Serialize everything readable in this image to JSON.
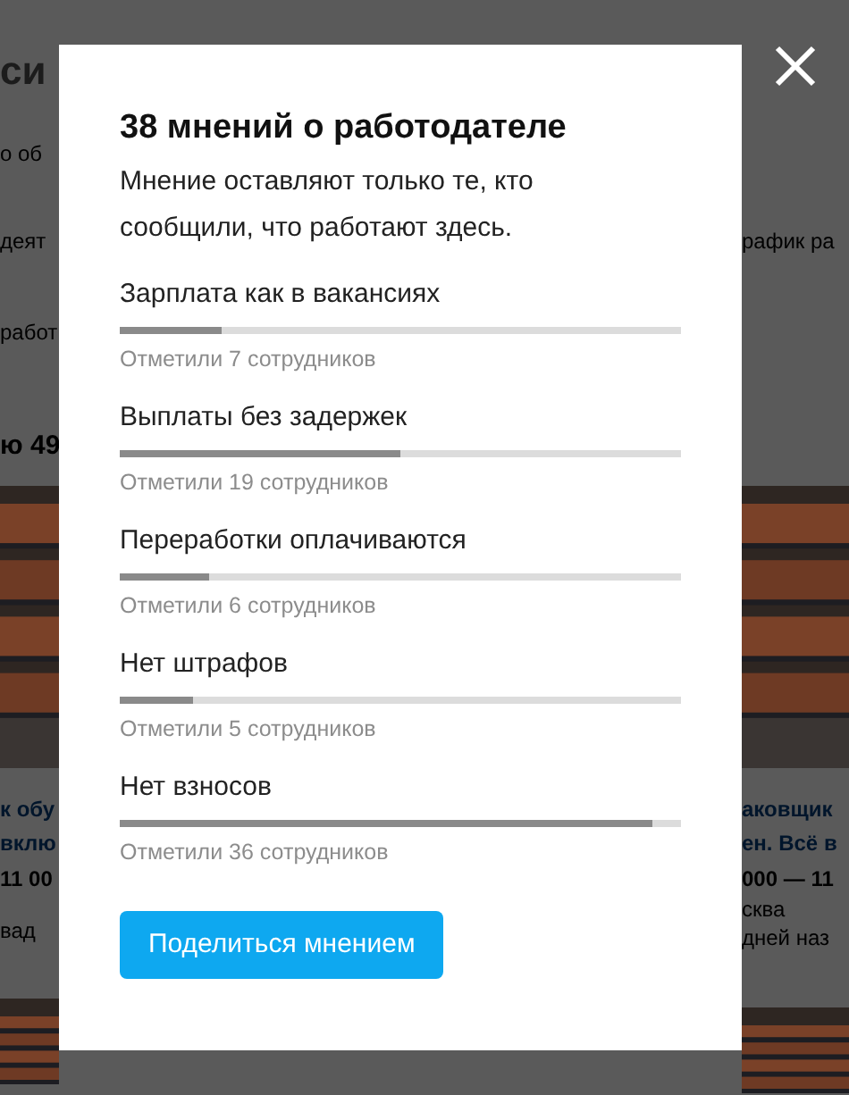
{
  "background": {
    "left": [
      {
        "kind": "title",
        "text": "си"
      },
      {
        "kind": "text",
        "text": "о об"
      },
      {
        "kind": "text",
        "text": "деят"
      },
      {
        "kind": "text",
        "text": "работ"
      },
      {
        "kind": "heading",
        "text": "ю 49"
      },
      {
        "kind": "picture"
      },
      {
        "kind": "link",
        "text": "к обу"
      },
      {
        "kind": "link",
        "text": "вклю"
      },
      {
        "kind": "salary",
        "text": "11 00"
      },
      {
        "kind": "muted",
        "text": "вад"
      },
      {
        "kind": "picture"
      }
    ],
    "right": [
      {
        "kind": "text",
        "text": "рафик ра"
      },
      {
        "kind": "picture"
      },
      {
        "kind": "link",
        "text": "аковщик"
      },
      {
        "kind": "link",
        "text": "ен. Всё в"
      },
      {
        "kind": "salary",
        "text": "000 — 11"
      },
      {
        "kind": "muted",
        "text": "сква"
      },
      {
        "kind": "muted",
        "text": "дней наз"
      },
      {
        "kind": "picture"
      }
    ]
  },
  "modal": {
    "title": "38 мнений о работодателе",
    "description": "Мнение оставляют только те, кто сообщили, что работают здесь.",
    "opinions": [
      {
        "label": "Зарплата как в вакансиях",
        "level": 0.18,
        "caption": "Отметили 7 сотрудников"
      },
      {
        "label": "Выплаты без задержек",
        "level": 0.5,
        "caption": "Отметили 19 сотрудников"
      },
      {
        "label": "Переработки оплачиваются",
        "level": 0.16,
        "caption": "Отметили 6 сотрудников"
      },
      {
        "label": "Нет штрафов",
        "level": 0.13,
        "caption": "Отметили 5 сотрудников"
      },
      {
        "label": "Нет взносов",
        "level": 0.95,
        "caption": "Отметили 36 сотрудников"
      }
    ],
    "button": "Поделиться мнением"
  }
}
